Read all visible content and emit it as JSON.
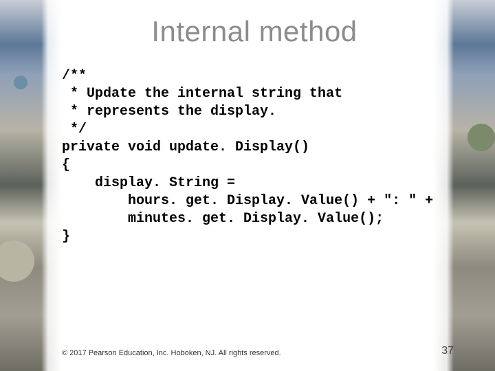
{
  "title": "Internal method",
  "code": "/**\n * Update the internal string that\n * represents the display.\n */\nprivate void update. Display()\n{\n    display. String =\n        hours. get. Display. Value() + \": \" +\n        minutes. get. Display. Value();\n}",
  "footer": {
    "copyright": "© 2017 Pearson Education, Inc. Hoboken, NJ. All rights reserved.",
    "page_number": "37"
  }
}
